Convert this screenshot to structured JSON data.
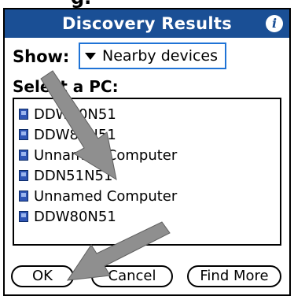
{
  "page_clip_text": "g.",
  "titlebar": {
    "title": "Discovery Results",
    "info_icon": "info-icon"
  },
  "show": {
    "label": "Show:",
    "value": "Nearby devices"
  },
  "select_label": "Select a PC:",
  "pc_list": [
    {
      "label": "DDW80N51",
      "icon": "computer-icon"
    },
    {
      "label": "DDW80N51",
      "icon": "computer-icon"
    },
    {
      "label": "Unnamed Computer",
      "icon": "computer-icon"
    },
    {
      "label": "DDN51N51",
      "icon": "computer-icon"
    },
    {
      "label": "Unnamed Computer",
      "icon": "computer-icon"
    },
    {
      "label": "DDW80N51",
      "icon": "computer-icon"
    }
  ],
  "buttons": {
    "ok": "OK",
    "cancel": "Cancel",
    "find_more": "Find More"
  },
  "colors": {
    "titlebar": "#1a4f95",
    "select_border": "#1f73d6",
    "pc_icon": "#2f55b5",
    "callout_arrow": "#8f8f8f"
  }
}
